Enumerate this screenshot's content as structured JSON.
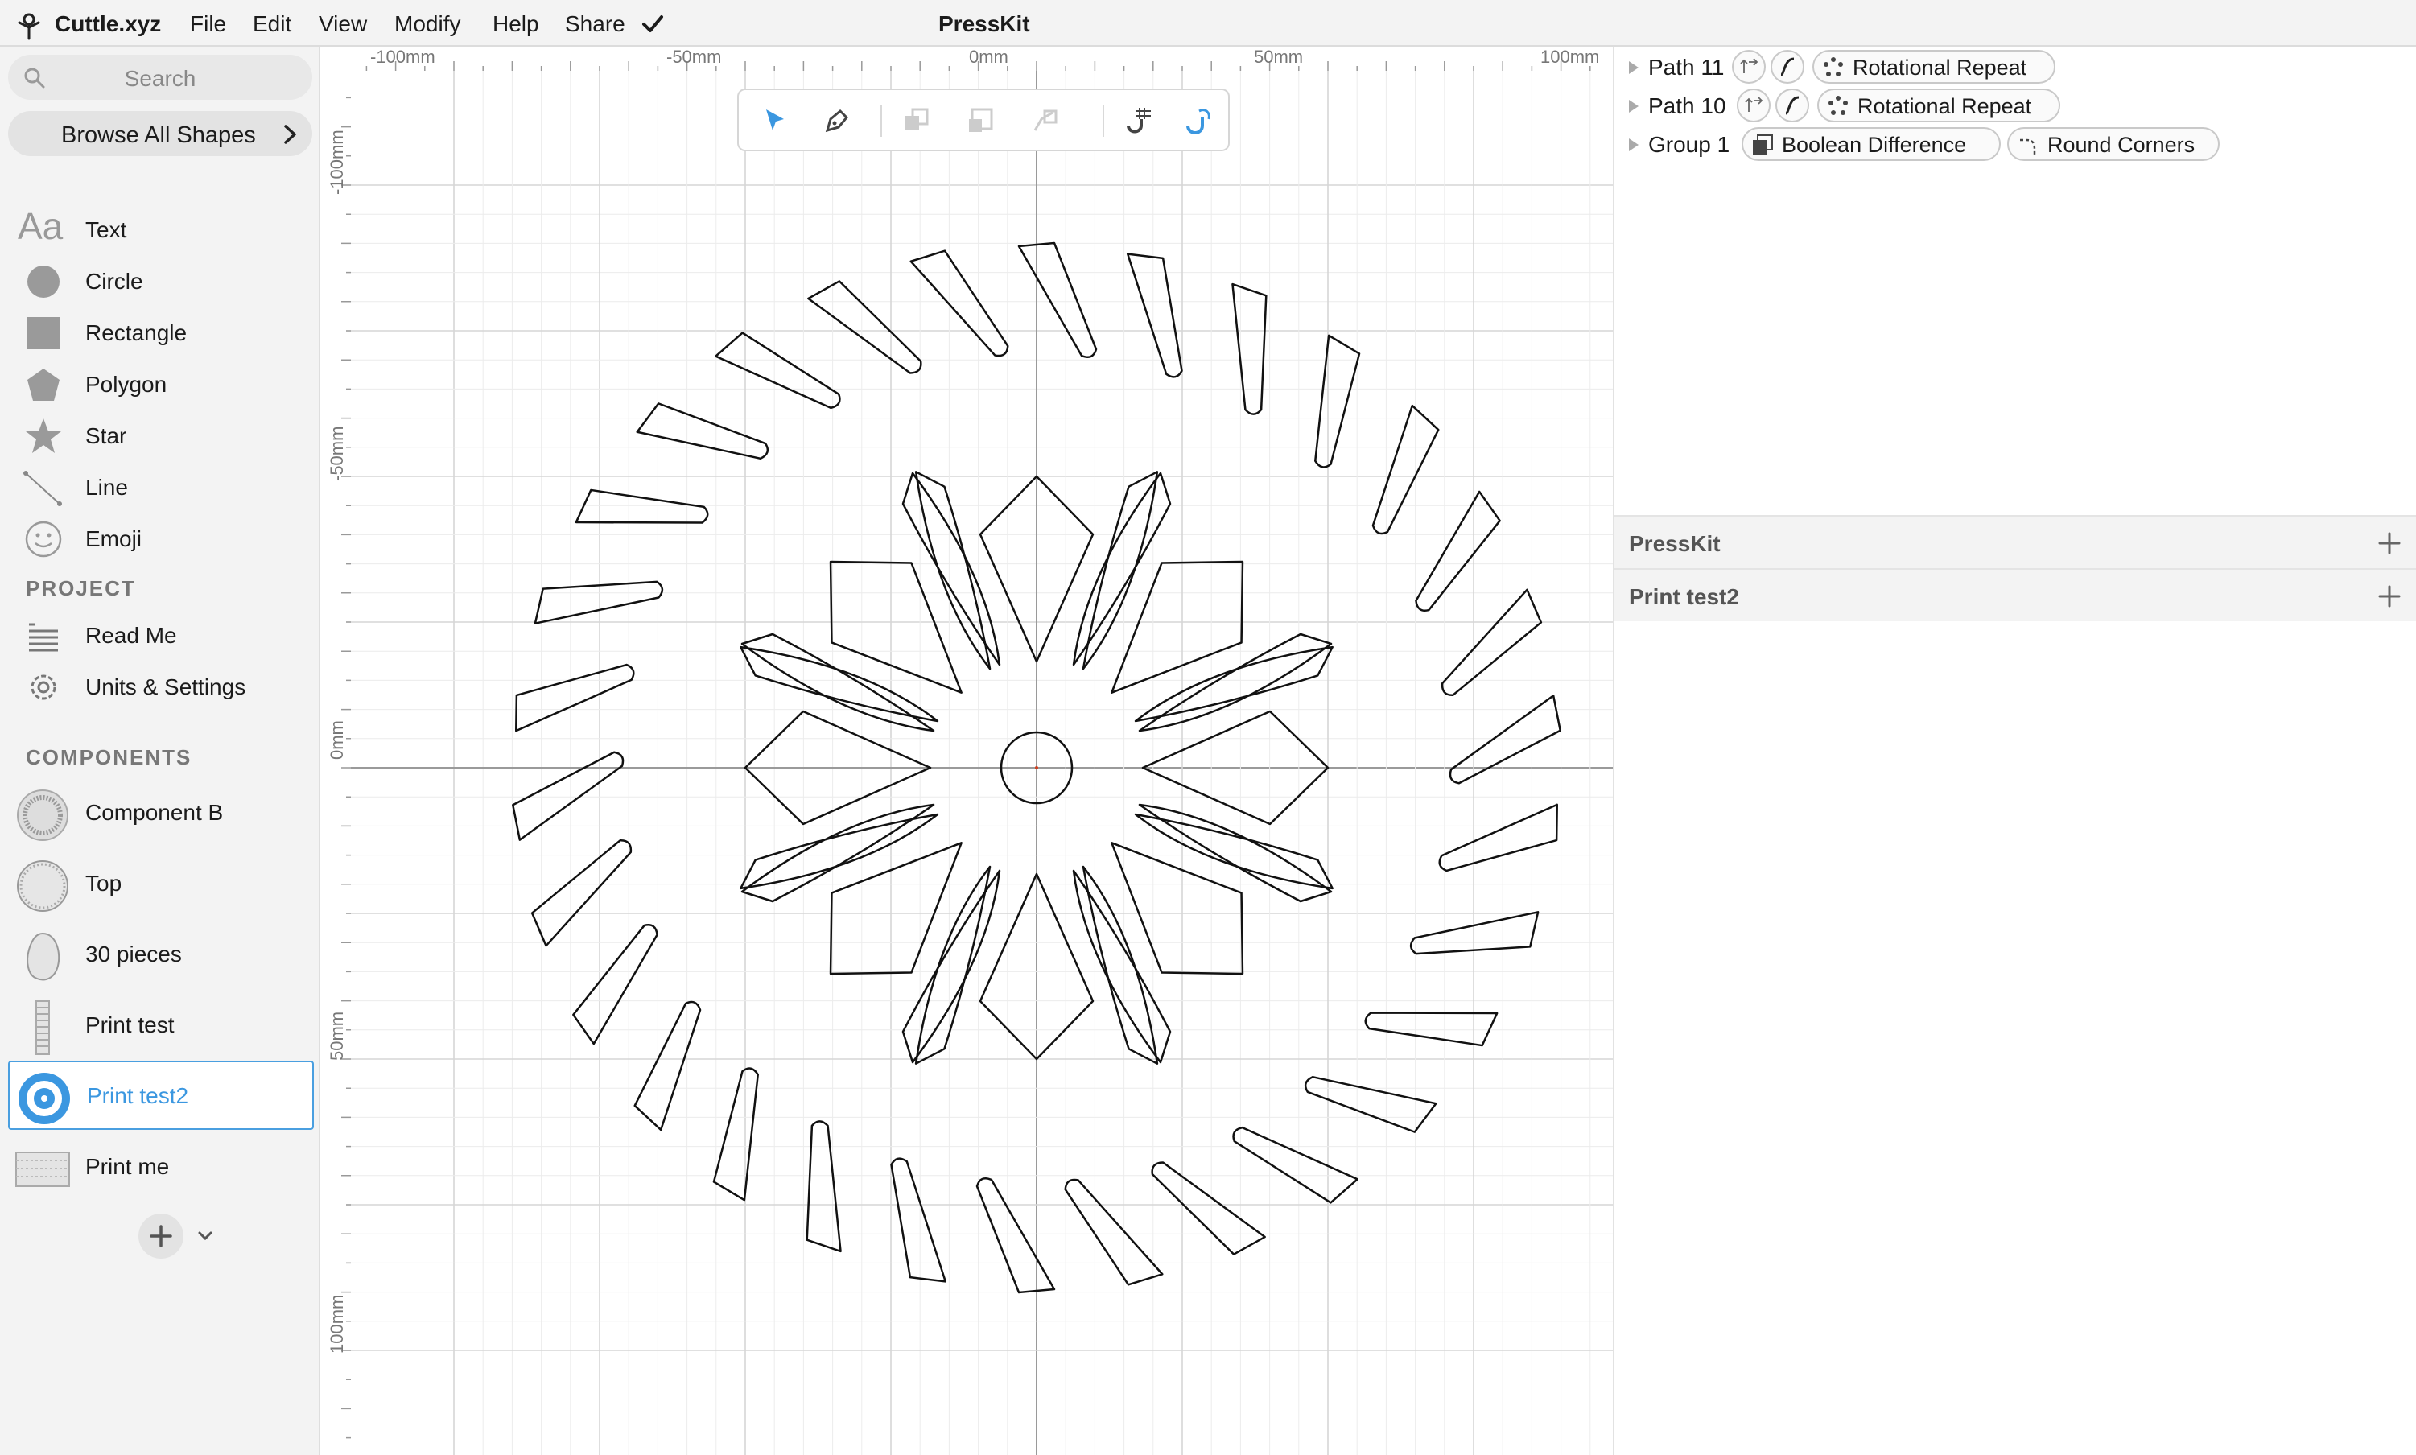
{
  "app": {
    "brand": "Cuttle.xyz",
    "menu": [
      "File",
      "Edit",
      "View",
      "Modify",
      "Help",
      "Share"
    ],
    "document_title": "PressKit"
  },
  "sidebar": {
    "search_placeholder": "Search",
    "browse_label": "Browse All Shapes",
    "shape_icons_text": "Aa",
    "shapes": [
      {
        "label": "Text",
        "icon": "text-icon"
      },
      {
        "label": "Circle",
        "icon": "circle-icon"
      },
      {
        "label": "Rectangle",
        "icon": "rectangle-icon"
      },
      {
        "label": "Polygon",
        "icon": "polygon-icon"
      },
      {
        "label": "Star",
        "icon": "star-icon"
      },
      {
        "label": "Line",
        "icon": "line-icon"
      },
      {
        "label": "Emoji",
        "icon": "emoji-icon"
      }
    ],
    "project_title": "PROJECT",
    "project_items": [
      {
        "label": "Read Me",
        "icon": "readme-icon"
      },
      {
        "label": "Units & Settings",
        "icon": "gear-icon"
      }
    ],
    "components_title": "COMPONENTS",
    "components": [
      {
        "label": "Component B",
        "selected": false
      },
      {
        "label": "Top",
        "selected": false
      },
      {
        "label": "30 pieces",
        "selected": false
      },
      {
        "label": "Print test",
        "selected": false
      },
      {
        "label": "Print test2",
        "selected": true
      },
      {
        "label": "Print me",
        "selected": false
      }
    ]
  },
  "canvas": {
    "ruler_x_labels": [
      "-100mm",
      "-50mm",
      "0mm",
      "50mm",
      "100mm"
    ],
    "ruler_y_labels": [
      "-100mm",
      "-50mm",
      "0mm",
      "50mm",
      "100mm"
    ],
    "tools": [
      "select-tool-icon",
      "pen-tool-icon",
      "send-back-icon",
      "scale-icon",
      "rotate-icon",
      "snap-grid-icon",
      "snap-magnet-icon"
    ],
    "accent_color": "#3b97e0"
  },
  "layers": [
    {
      "name": "Path 11",
      "modifiers": [
        "Rotational Repeat"
      ]
    },
    {
      "name": "Path 10",
      "modifiers": [
        "Rotational Repeat"
      ]
    },
    {
      "name": "Group 1",
      "modifiers": [
        "Boolean Difference",
        "Round Corners"
      ]
    }
  ],
  "panes": [
    "PressKit",
    "Print test2"
  ]
}
